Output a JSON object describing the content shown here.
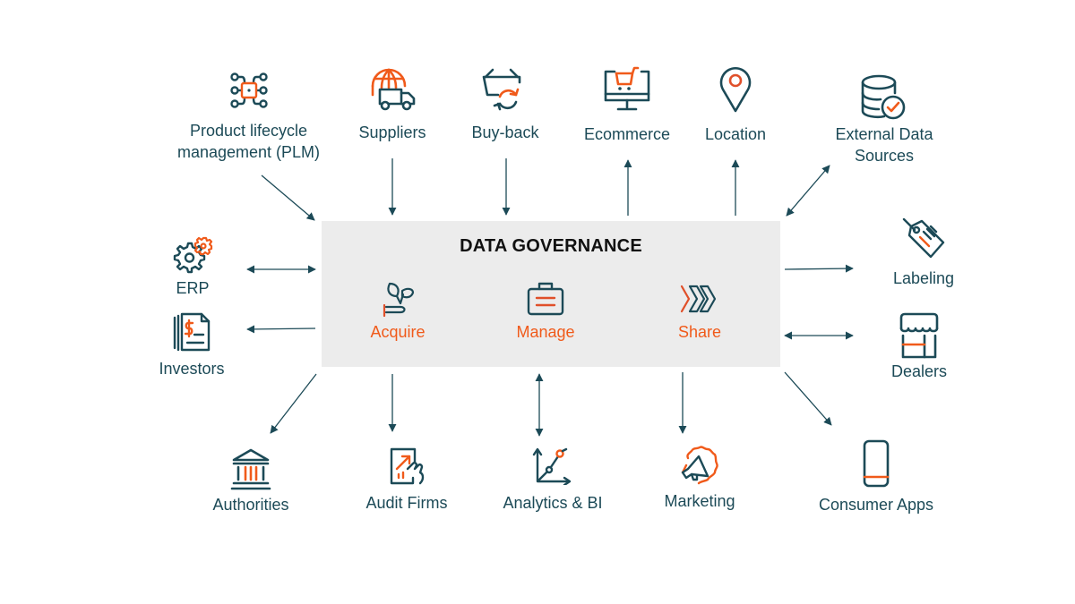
{
  "hub": {
    "title": "DATA GOVERNANCE",
    "pillars": [
      {
        "label": "Acquire",
        "icon": "plant-hand-icon"
      },
      {
        "label": "Manage",
        "icon": "briefcase-icon"
      },
      {
        "label": "Share",
        "icon": "chevrons-right-icon"
      }
    ]
  },
  "colors": {
    "primary": "#1c4a57",
    "accent": "#f05a1a",
    "hub_background": "#ececec"
  },
  "nodes": {
    "plm": {
      "label_line1": "Product lifecycle",
      "label_line2": "management (PLM)",
      "icon": "circuit-chip-icon",
      "flow": "inbound"
    },
    "suppliers": {
      "label": "Suppliers",
      "icon": "globe-truck-icon",
      "flow": "inbound"
    },
    "buyback": {
      "label": "Buy-back",
      "icon": "basket-refresh-icon",
      "flow": "inbound"
    },
    "ecommerce": {
      "label": "Ecommerce",
      "icon": "monitor-cart-icon",
      "flow": "outbound"
    },
    "location": {
      "label": "Location",
      "icon": "map-pin-icon",
      "flow": "outbound"
    },
    "external": {
      "label_line1": "External Data",
      "label_line2": "Sources",
      "icon": "database-check-icon",
      "flow": "bidirectional"
    },
    "erp": {
      "label": "ERP",
      "icon": "gears-icon",
      "flow": "bidirectional"
    },
    "investors": {
      "label": "Investors",
      "icon": "financial-document-icon",
      "flow": "outbound"
    },
    "labeling": {
      "label": "Labeling",
      "icon": "price-tag-icon",
      "flow": "outbound"
    },
    "dealers": {
      "label": "Dealers",
      "icon": "storefront-icon",
      "flow": "bidirectional"
    },
    "authorities": {
      "label": "Authorities",
      "icon": "government-building-icon",
      "flow": "outbound"
    },
    "audit": {
      "label": "Audit Firms",
      "icon": "tablet-chart-icon",
      "flow": "outbound"
    },
    "analytics": {
      "label": "Analytics & BI",
      "icon": "line-chart-icon",
      "flow": "bidirectional"
    },
    "marketing": {
      "label": "Marketing",
      "icon": "megaphone-badge-icon",
      "flow": "outbound"
    },
    "consumer": {
      "label": "Consumer Apps",
      "icon": "smartphone-icon",
      "flow": "outbound"
    }
  }
}
